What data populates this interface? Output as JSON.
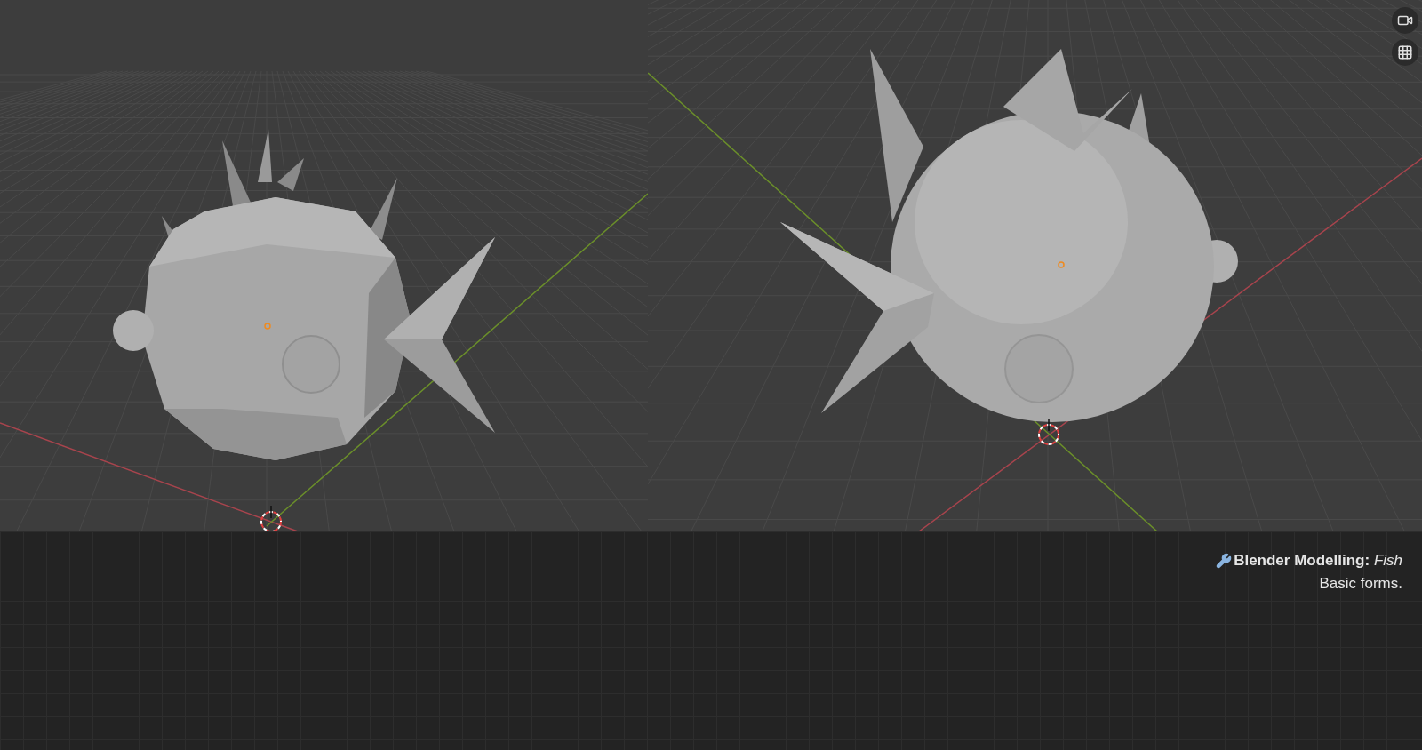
{
  "caption": {
    "title": "**Blender Modelling:** *Fish*",
    "subtitle": "Basic forms."
  }
}
